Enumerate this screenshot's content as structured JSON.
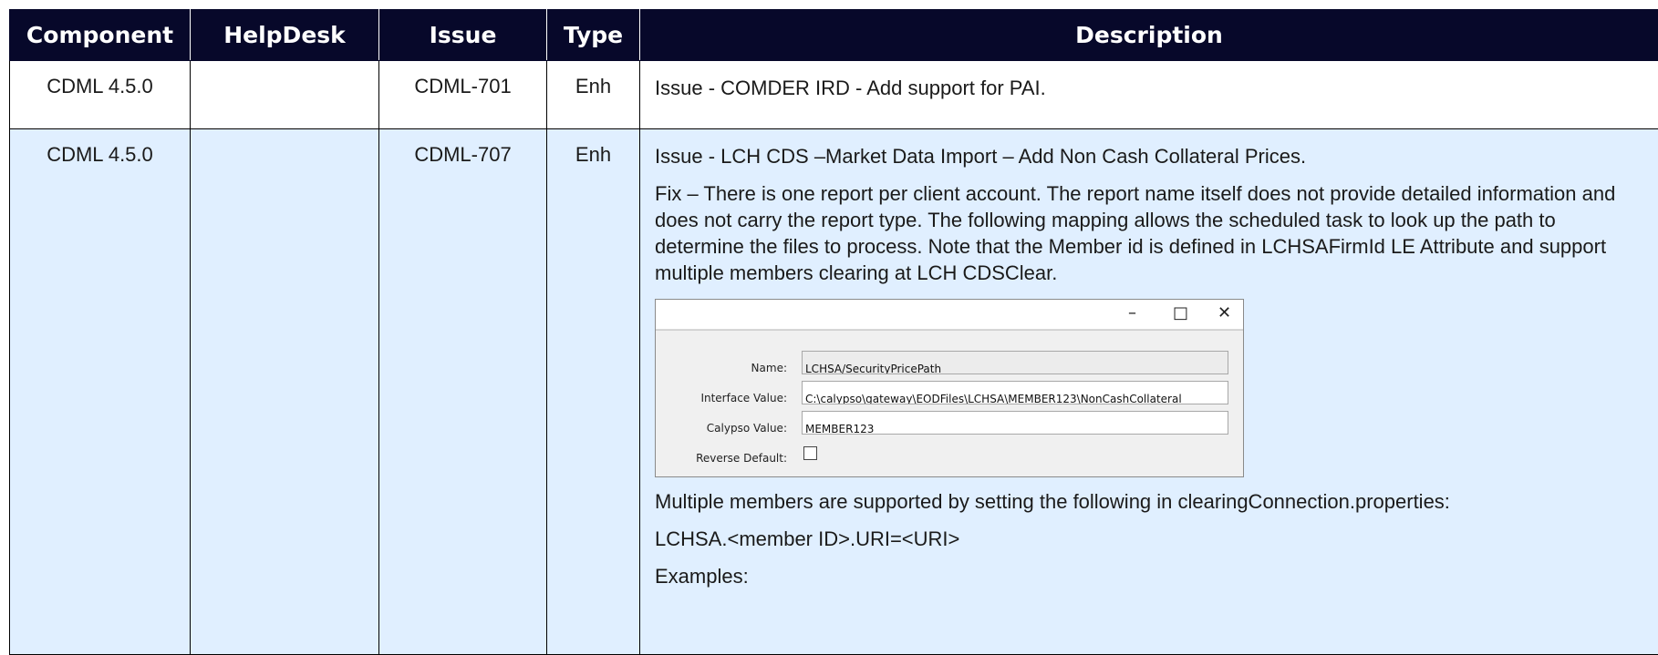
{
  "headers": [
    "Component",
    "HelpDesk",
    "Issue",
    "Type",
    "Description"
  ],
  "rows": [
    {
      "component": "CDML 4.5.0",
      "helpdesk": "",
      "issue": "CDML-701",
      "type": "Enh",
      "description": [
        "Issue - COMDER IRD - Add support for PAI."
      ]
    },
    {
      "component": "CDML 4.5.0",
      "helpdesk": "",
      "issue": "CDML-707",
      "type": "Enh",
      "description": [
        "Issue - LCH CDS –Market Data Import – Add Non Cash Collateral Prices.",
        "Fix – There is one report per client account. The report name itself does not provide detailed information and does not carry the report type. The following mapping allows the scheduled task to look up the path to determine the files to process. Note that the Member id is defined in LCHSAFirmId LE Attribute and support multiple members clearing at LCH CDSClear.",
        "Multiple members are supported by setting the following in clearingConnection.properties:",
        "LCHSA.<member ID>.URI=<URI>",
        "Examples:"
      ]
    }
  ],
  "dialog": {
    "controls": {
      "minimize": "–",
      "maximize": "□",
      "close": "✕"
    },
    "fields": [
      {
        "label": "Name:",
        "value": "LCHSA/SecurityPricePath"
      },
      {
        "label": "Interface Value:",
        "value": "C:\\calypso\\gateway\\EODFiles\\LCHSA\\MEMBER123\\NonCashCollateral"
      },
      {
        "label": "Calypso Value:",
        "value": "MEMBER123"
      },
      {
        "label": "Reverse Default:",
        "value": ""
      }
    ]
  }
}
